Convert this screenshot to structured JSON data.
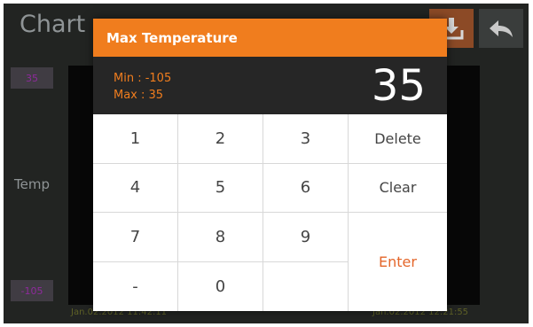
{
  "screen": {
    "title": "Chart",
    "y_axis_label": "Temp",
    "y_top": "35",
    "y_bottom": "-105",
    "start_time": "Jan.02.2012  11:42:11",
    "end_time": "Jan.02.2012  12:21:55",
    "accent_color": "#f07d1e"
  },
  "dialog": {
    "title": "Max Temperature",
    "min_label": "Min :  -105",
    "max_label": "Max : 35",
    "value": "35"
  },
  "keypad": {
    "k1": "1",
    "k2": "2",
    "k3": "3",
    "k4": "4",
    "k5": "5",
    "k6": "6",
    "k7": "7",
    "k8": "8",
    "k9": "9",
    "minus": "-",
    "k0": "0",
    "delete": "Delete",
    "clear": "Clear",
    "enter": "Enter"
  }
}
